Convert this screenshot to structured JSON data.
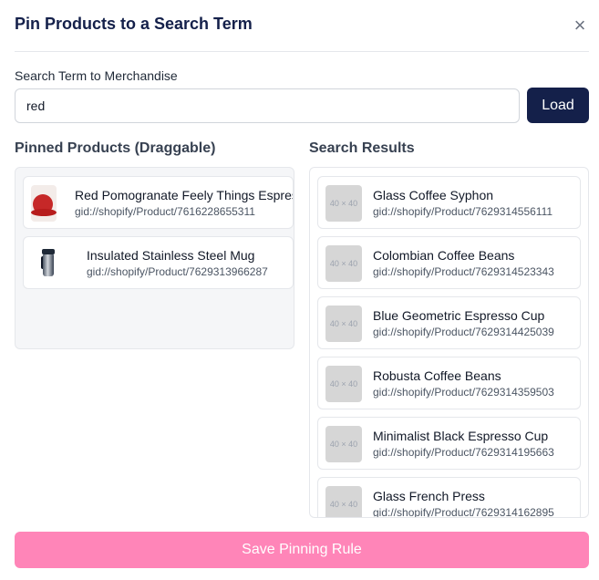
{
  "dialog": {
    "title": "Pin Products to a Search Term",
    "close_icon": "×"
  },
  "search": {
    "label": "Search Term to Merchandise",
    "value": "red",
    "load_label": "Load"
  },
  "pinned": {
    "title": "Pinned Products (Draggable)",
    "items": [
      {
        "name": "Red Pomogranate Feely Things Espresso Cups",
        "id": "gid://shopify/Product/7616228655311",
        "thumb": "red-cups-image"
      },
      {
        "name": "Insulated Stainless Steel Mug",
        "id": "gid://shopify/Product/7629313966287",
        "thumb": "steel-mug-image"
      }
    ]
  },
  "results": {
    "title": "Search Results",
    "placeholder_text": "40 × 40",
    "items": [
      {
        "name": "Glass Coffee Syphon",
        "id": "gid://shopify/Product/7629314556111"
      },
      {
        "name": "Colombian Coffee Beans",
        "id": "gid://shopify/Product/7629314523343"
      },
      {
        "name": "Blue Geometric Espresso Cup",
        "id": "gid://shopify/Product/7629314425039"
      },
      {
        "name": "Robusta Coffee Beans",
        "id": "gid://shopify/Product/7629314359503"
      },
      {
        "name": "Minimalist Black Espresso Cup",
        "id": "gid://shopify/Product/7629314195663"
      },
      {
        "name": "Glass French Press",
        "id": "gid://shopify/Product/7629314162895"
      }
    ]
  },
  "footer": {
    "save_label": "Save Pinning Rule"
  },
  "colors": {
    "primary": "#14204a",
    "save_button": "#ff85b8"
  }
}
